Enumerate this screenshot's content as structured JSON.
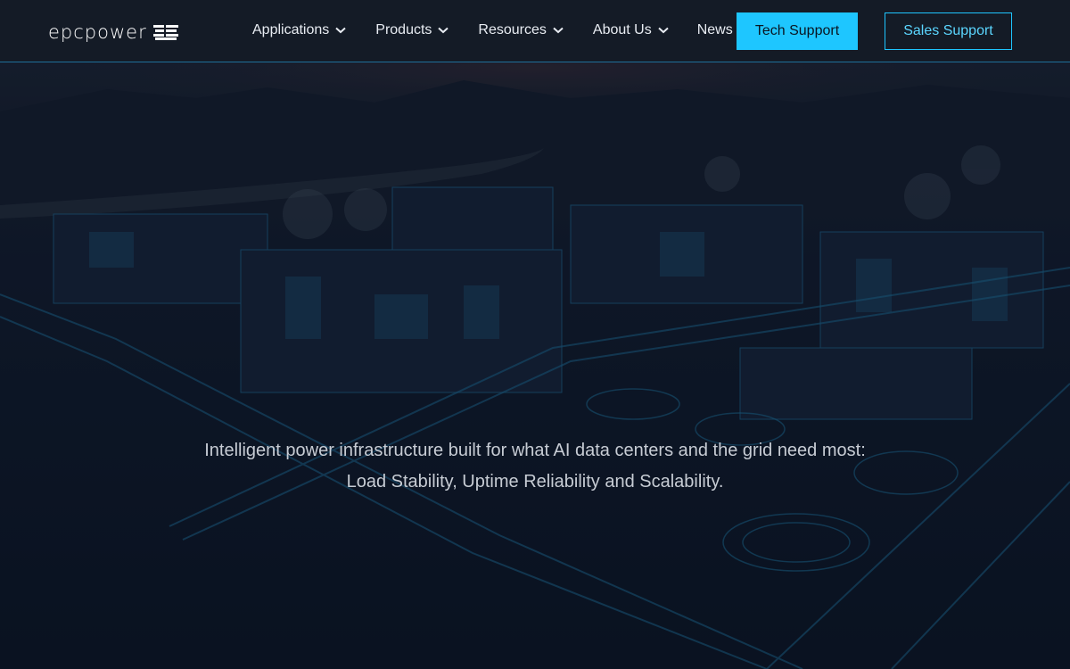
{
  "brand": {
    "name": "epcpower",
    "logo_icon": "epc-stack-icon"
  },
  "nav": {
    "items": [
      {
        "label": "Applications",
        "has_dropdown": true
      },
      {
        "label": "Products",
        "has_dropdown": true
      },
      {
        "label": "Resources",
        "has_dropdown": true
      },
      {
        "label": "About Us",
        "has_dropdown": true
      },
      {
        "label": "News",
        "has_dropdown": false
      }
    ]
  },
  "actions": {
    "tech_support": "Tech Support",
    "sales_support": "Sales Support"
  },
  "hero": {
    "line1": "Intelligent power infrastructure built for what AI data centers and the grid need most:",
    "line2": "Load Stability, Uptime Reliability and Scalability."
  },
  "colors": {
    "accent": "#1ec6ff",
    "header_bg": "#141b26",
    "hero_bg": "#0c1526"
  }
}
